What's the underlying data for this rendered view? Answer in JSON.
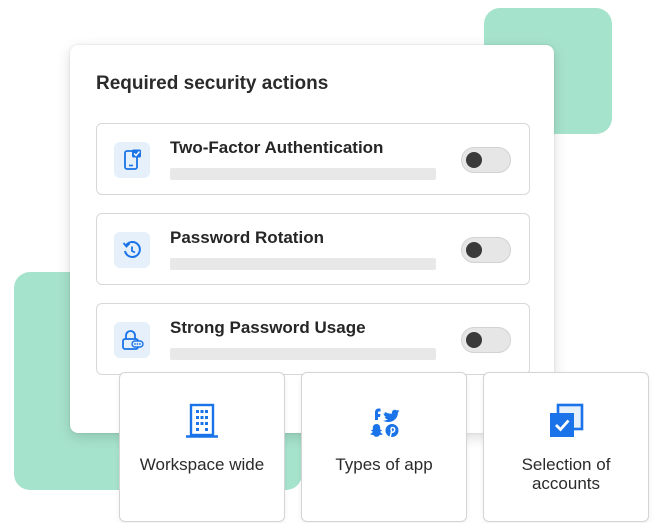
{
  "colors": {
    "accent": "#1a73e8",
    "mint": "#a6e3cd",
    "icon_bg": "#e5f0fb"
  },
  "card": {
    "title": "Required security actions",
    "actions": [
      {
        "label": "Two-Factor Authentication",
        "icon": "phone-check-icon",
        "enabled": false
      },
      {
        "label": "Password Rotation",
        "icon": "clock-rotate-icon",
        "enabled": false
      },
      {
        "label": "Strong Password Usage",
        "icon": "lock-password-icon",
        "enabled": false
      }
    ]
  },
  "scopes": [
    {
      "label": "Workspace wide",
      "icon": "building-icon"
    },
    {
      "label": "Types of app",
      "icon": "social-apps-icon"
    },
    {
      "label": "Selection of accounts",
      "icon": "multi-select-icon"
    }
  ]
}
